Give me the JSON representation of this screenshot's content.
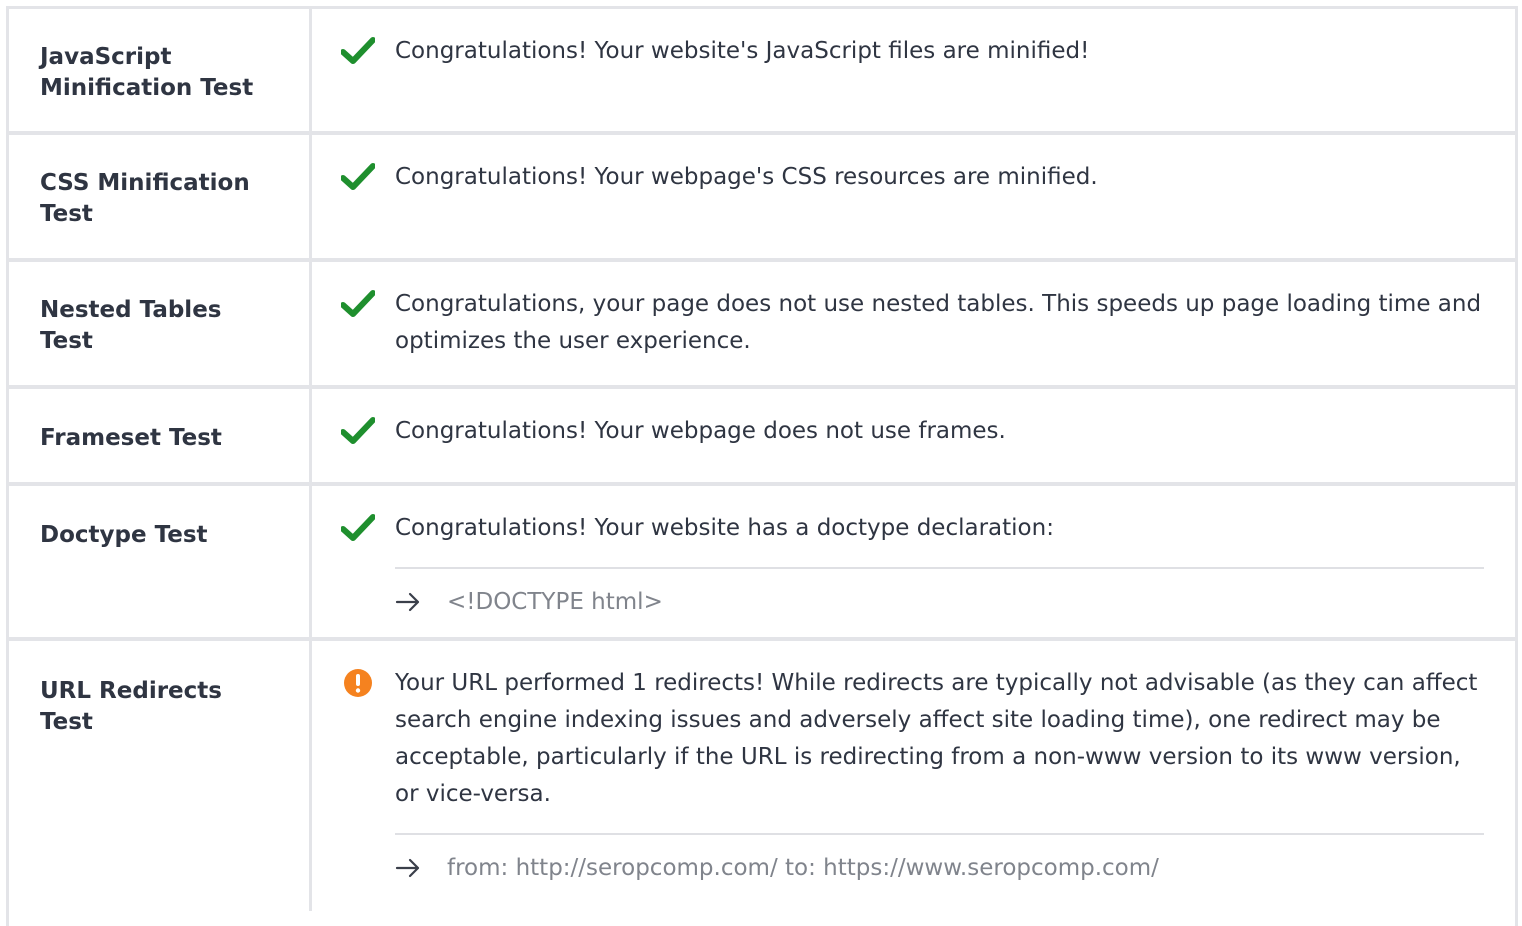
{
  "colors": {
    "pass": "#1f8f2e",
    "warn": "#f5821f",
    "border": "#e3e4e8",
    "text": "#2f3542",
    "muted": "#80848c"
  },
  "rows": [
    {
      "label": "JavaScript Minification Test",
      "status": "check-icon",
      "message": "Congratulations! Your website's JavaScript files are minified!"
    },
    {
      "label": "CSS Minification Test",
      "status": "check-icon",
      "message": "Congratulations! Your webpage's CSS resources are minified."
    },
    {
      "label": "Nested Tables Test",
      "status": "check-icon",
      "message": "Congratulations, your page does not use nested tables. This speeds up page loading time and optimizes the user experience."
    },
    {
      "label": "Frameset Test",
      "status": "check-icon",
      "message": "Congratulations! Your webpage does not use frames."
    },
    {
      "label": "Doctype Test",
      "status": "check-icon",
      "message": "Congratulations! Your website has a doctype declaration:",
      "detail": "<!DOCTYPE html>"
    },
    {
      "label": "URL Redirects Test",
      "status": "warning-icon",
      "message": "Your URL performed 1 redirects! While redirects are typically not advisable (as they can affect search engine indexing issues and adversely affect site loading time), one redirect may be acceptable, particularly if the URL is redirecting from a non-www version to its www version, or vice-versa.",
      "detail": "from: http://seropcomp.com/ to: https://www.seropcomp.com/"
    }
  ]
}
